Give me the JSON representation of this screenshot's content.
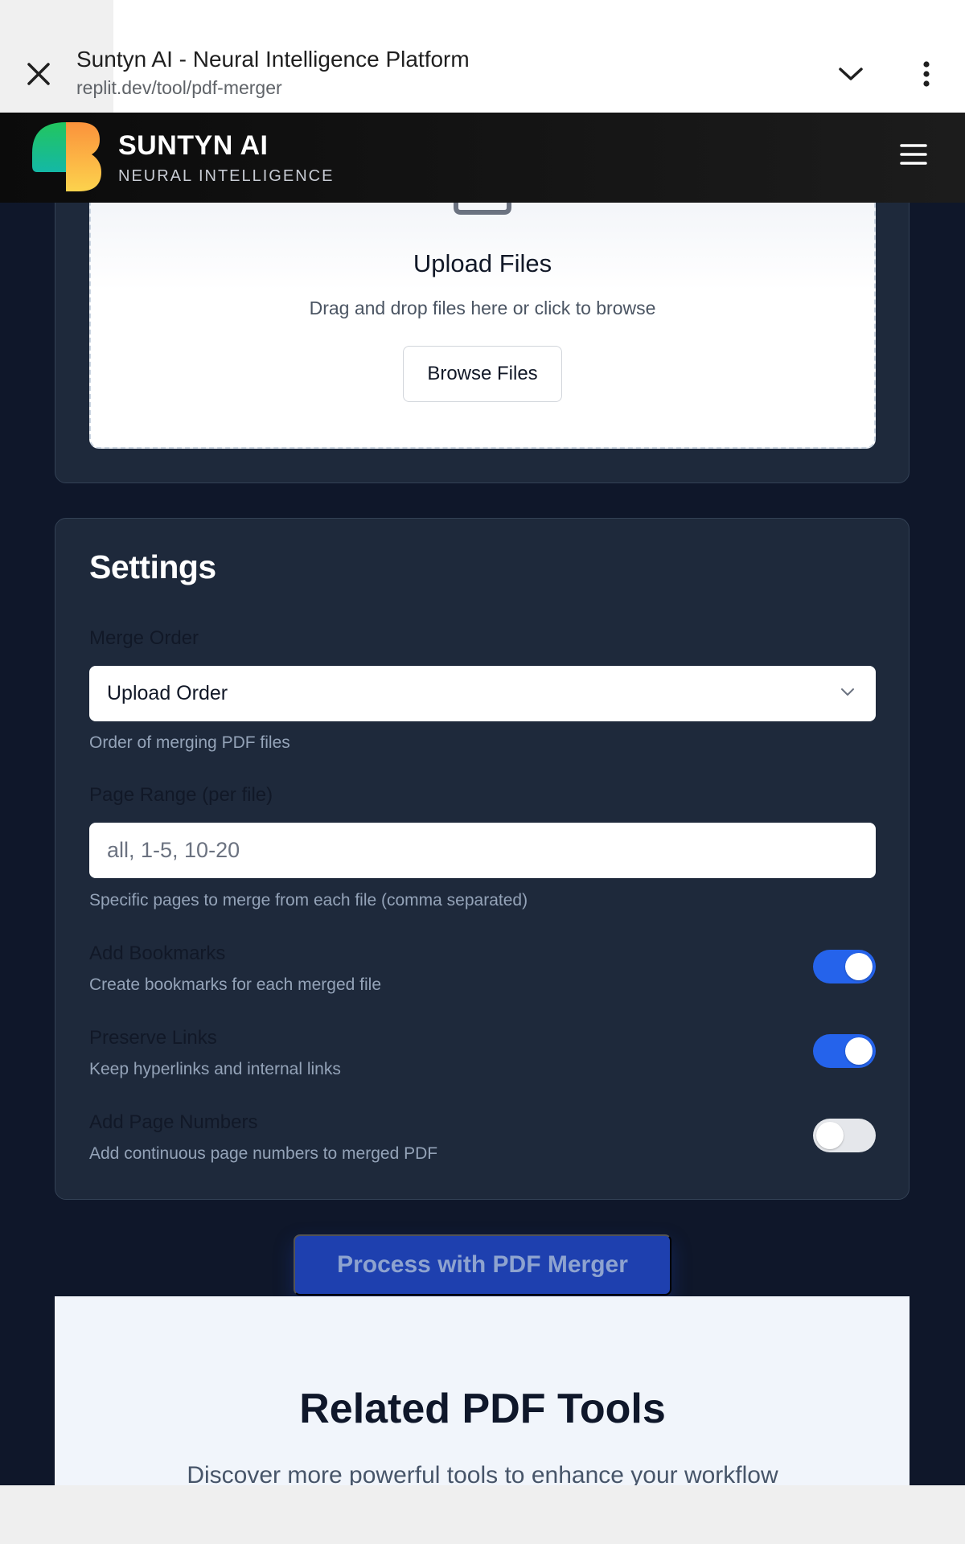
{
  "browser": {
    "title": "Suntyn AI - Neural Intelligence Platform",
    "url": "replit.dev/tool/pdf-merger"
  },
  "header": {
    "brand": "SUNTYN AI",
    "tagline": "NEURAL INTELLIGENCE"
  },
  "upload": {
    "title": "Upload Files",
    "subtitle": "Drag and drop files here or click to browse",
    "browse_label": "Browse Files"
  },
  "settings": {
    "title": "Settings",
    "merge_order": {
      "label": "Merge Order",
      "value": "Upload Order",
      "help": "Order of merging PDF files"
    },
    "page_range": {
      "label": "Page Range (per file)",
      "placeholder": "all, 1-5, 10-20",
      "help": "Specific pages to merge from each file (comma separated)"
    },
    "toggles": [
      {
        "label": "Add Bookmarks",
        "help": "Create bookmarks for each merged file",
        "on": true
      },
      {
        "label": "Preserve Links",
        "help": "Keep hyperlinks and internal links",
        "on": true
      },
      {
        "label": "Add Page Numbers",
        "help": "Add continuous page numbers to merged PDF",
        "on": false
      }
    ]
  },
  "process_label": "Process with PDF Merger",
  "related": {
    "title": "Related PDF Tools",
    "subtitle": "Discover more powerful tools to enhance your workflow"
  },
  "colors": {
    "accent": "#2563eb",
    "page_bg": "#0f172a",
    "card_bg": "#1e293b"
  }
}
